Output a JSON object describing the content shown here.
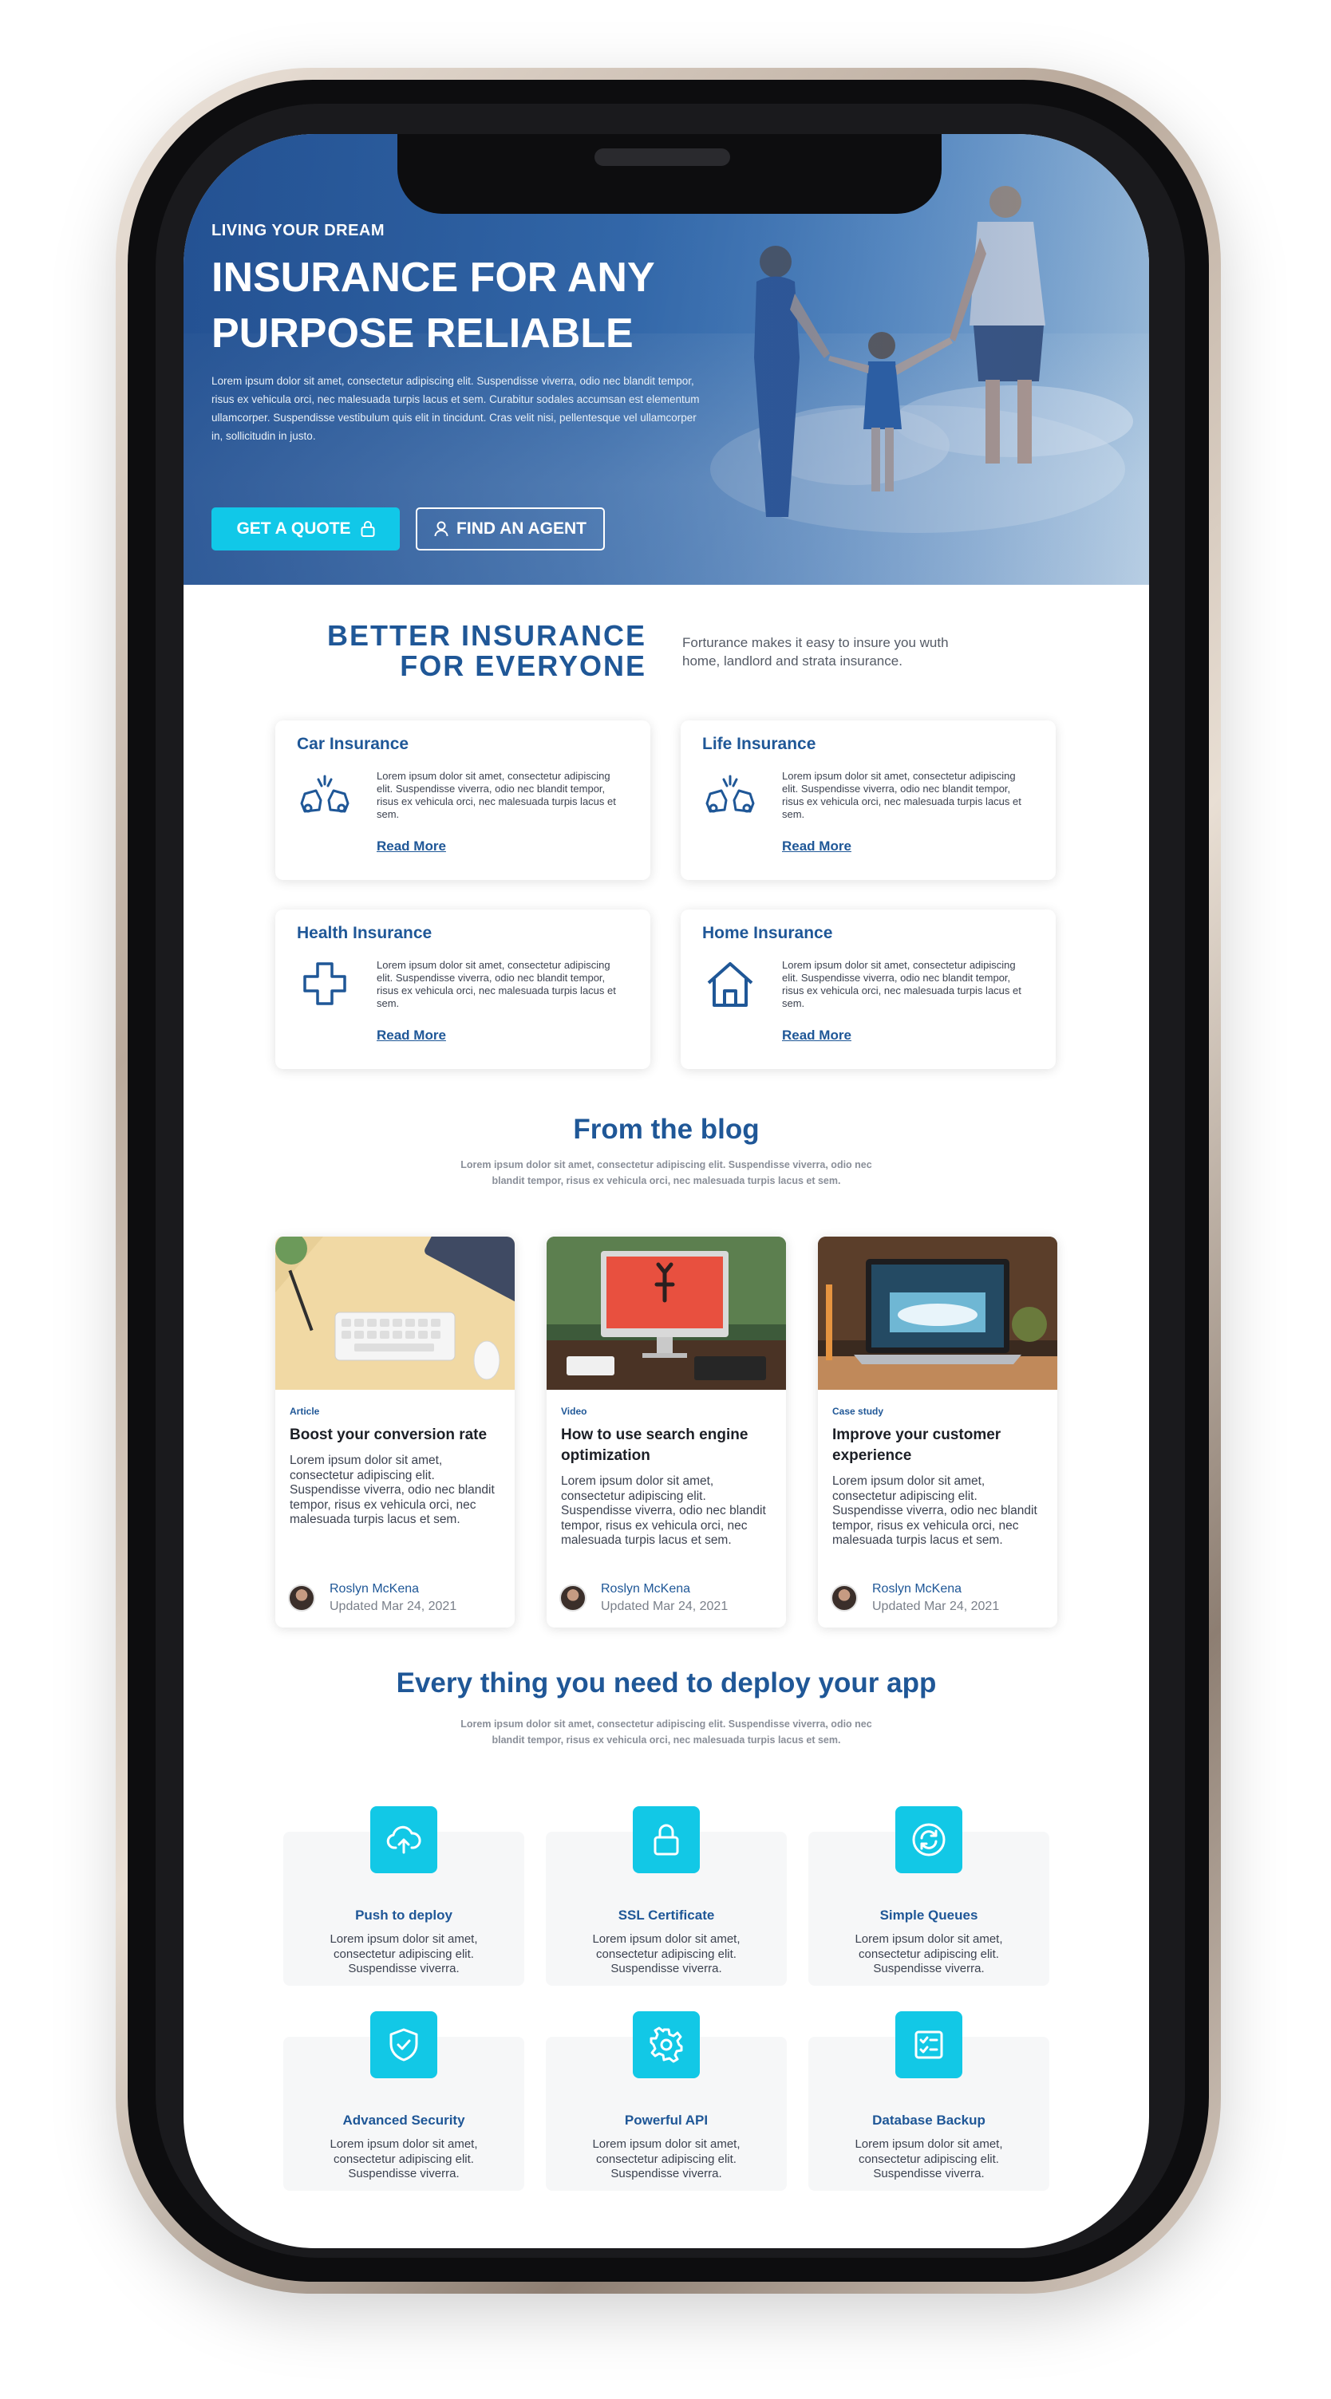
{
  "hero": {
    "eyebrow": "LIVING YOUR DREAM",
    "title": "INSURANCE FOR ANY PURPOSE RELIABLE",
    "body": "Lorem ipsum dolor sit amet, consectetur adipiscing elit. Suspendisse viverra, odio nec blandit tempor, risus ex vehicula orci, nec malesuada turpis lacus et sem. Curabitur sodales accumsan est elementum ullamcorper. Suspendisse vestibulum quis elit in tincidunt. Cras velit nisi, pellentesque vel ullamcorper in, sollicitudin in justo.",
    "primary_button": "GET A QUOTE",
    "secondary_button": "FIND AN AGENT"
  },
  "intro": {
    "heading_line1": "BETTER INSURANCE",
    "heading_line2": "FOR EVERYONE",
    "text": "Forturance makes it easy to insure you wuth home, landlord and strata insurance."
  },
  "insurance": [
    {
      "title": "Car Insurance",
      "icon": "car-crash-icon",
      "text": "Lorem ipsum dolor sit amet, consectetur adipiscing elit. Suspendisse viverra, odio nec blandit tempor, risus ex vehicula orci, nec malesuada turpis lacus et sem.",
      "link": "Read More"
    },
    {
      "title": "Life Insurance",
      "icon": "car-crash-icon",
      "text": "Lorem ipsum dolor sit amet, consectetur adipiscing elit. Suspendisse viverra, odio nec blandit tempor, risus ex vehicula orci, nec malesuada turpis lacus et sem.",
      "link": "Read More"
    },
    {
      "title": "Health Insurance",
      "icon": "medical-cross-icon",
      "text": "Lorem ipsum dolor sit amet, consectetur adipiscing elit. Suspendisse viverra, odio nec blandit tempor, risus ex vehicula orci, nec malesuada turpis lacus et sem.",
      "link": "Read More"
    },
    {
      "title": "Home Insurance",
      "icon": "house-icon",
      "text": "Lorem ipsum dolor sit amet, consectetur adipiscing elit. Suspendisse viverra, odio nec blandit tempor, risus ex vehicula orci, nec malesuada turpis lacus et sem.",
      "link": "Read More"
    }
  ],
  "blog": {
    "title": "From the blog",
    "subtitle": "Lorem ipsum dolor sit amet, consectetur adipiscing elit. Suspendisse viverra, odio nec blandit tempor, risus ex vehicula orci, nec malesuada turpis lacus et sem.",
    "posts": [
      {
        "tag": "Article",
        "title": "Boost your conversion rate",
        "excerpt": "Lorem ipsum dolor sit amet, consectetur adipiscing elit. Suspendisse viverra, odio nec blandit tempor, risus ex vehicula orci, nec malesuada turpis lacus et sem.",
        "author": "Roslyn McKena",
        "date": "Updated Mar 24, 2021"
      },
      {
        "tag": "Video",
        "title": "How to use search engine optimization",
        "excerpt": "Lorem ipsum dolor sit amet, consectetur adipiscing elit. Suspendisse viverra, odio nec blandit tempor, risus ex vehicula orci, nec malesuada turpis lacus et sem.",
        "author": "Roslyn McKena",
        "date": "Updated Mar 24, 2021"
      },
      {
        "tag": "Case study",
        "title": "Improve your customer experience",
        "excerpt": "Lorem ipsum dolor sit amet, consectetur adipiscing elit. Suspendisse viverra, odio nec blandit tempor, risus ex vehicula orci, nec malesuada turpis lacus et sem.",
        "author": "Roslyn McKena",
        "date": "Updated Mar 24, 2021"
      }
    ]
  },
  "features": {
    "title": "Every thing you need to deploy your app",
    "subtitle": "Lorem ipsum dolor sit amet, consectetur adipiscing elit. Suspendisse viverra, odio nec blandit tempor, risus ex vehicula orci, nec malesuada turpis lacus et sem.",
    "items": [
      {
        "title": "Push to deploy",
        "icon": "cloud-upload-icon",
        "text": "Lorem ipsum dolor sit amet, consectetur adipiscing elit. Suspendisse viverra."
      },
      {
        "title": "SSL Certificate",
        "icon": "lock-icon",
        "text": "Lorem ipsum dolor sit amet, consectetur adipiscing elit. Suspendisse viverra."
      },
      {
        "title": "Simple Queues",
        "icon": "refresh-icon",
        "text": "Lorem ipsum dolor sit amet, consectetur adipiscing elit. Suspendisse viverra."
      },
      {
        "title": "Advanced Security",
        "icon": "shield-check-icon",
        "text": "Lorem ipsum dolor sit amet, consectetur adipiscing elit. Suspendisse viverra."
      },
      {
        "title": "Powerful API",
        "icon": "gear-icon",
        "text": "Lorem ipsum dolor sit amet, consectetur adipiscing elit. Suspendisse viverra."
      },
      {
        "title": "Database Backup",
        "icon": "checklist-icon",
        "text": "Lorem ipsum dolor sit amet, consectetur adipiscing elit. Suspendisse viverra."
      }
    ]
  },
  "colors": {
    "brand_blue": "#1f5797",
    "accent_cyan": "#11c8e8",
    "body_text": "#3c4250"
  }
}
